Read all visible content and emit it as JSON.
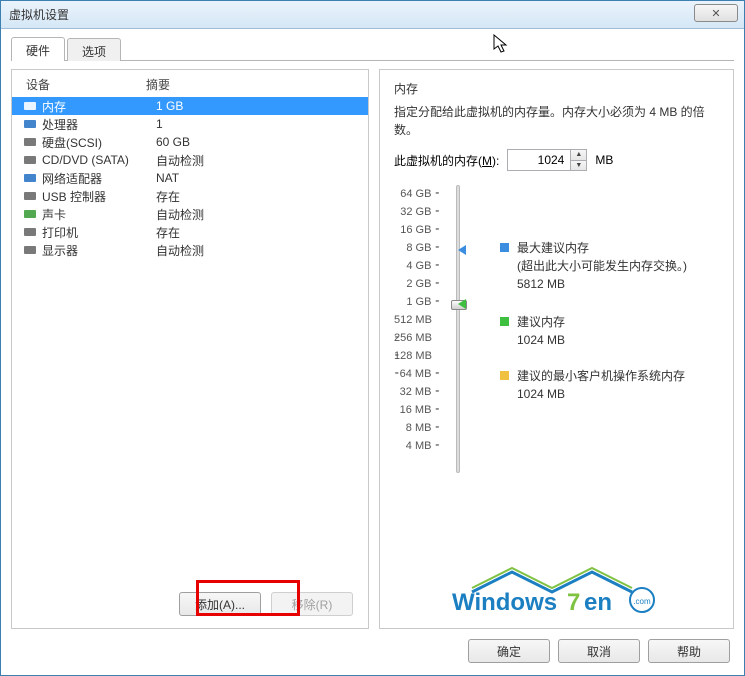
{
  "window": {
    "title": "虚拟机设置",
    "close": "✕"
  },
  "tabs": {
    "hardware": "硬件",
    "options": "选项"
  },
  "deviceHeader": {
    "device": "设备",
    "summary": "摘要"
  },
  "devices": [
    {
      "name": "内存",
      "summary": "1 GB",
      "selected": true
    },
    {
      "name": "处理器",
      "summary": "1"
    },
    {
      "name": "硬盘(SCSI)",
      "summary": "60 GB"
    },
    {
      "name": "CD/DVD (SATA)",
      "summary": "自动检测"
    },
    {
      "name": "网络适配器",
      "summary": "NAT"
    },
    {
      "name": "USB 控制器",
      "summary": "存在"
    },
    {
      "name": "声卡",
      "summary": "自动检测"
    },
    {
      "name": "打印机",
      "summary": "存在"
    },
    {
      "name": "显示器",
      "summary": "自动检测"
    }
  ],
  "leftButtons": {
    "add": "添加(A)...",
    "remove": "移除(R)"
  },
  "memory": {
    "title": "内存",
    "desc": "指定分配给此虚拟机的内存量。内存大小必须为 4 MB 的倍数。",
    "label_pre": "此虚拟机的内存(",
    "label_u": "M",
    "label_post": "):",
    "value": "1024",
    "unit": "MB",
    "scale": [
      "64 GB",
      "32 GB",
      "16 GB",
      "8 GB",
      "4 GB",
      "2 GB",
      "1 GB",
      "512 MB",
      "256 MB",
      "128 MB",
      "64 MB",
      "32 MB",
      "16 MB",
      "8 MB",
      "4 MB"
    ],
    "max_rec_title": "最大建议内存",
    "max_rec_desc": "(超出此大小可能发生内存交换。)",
    "max_rec_val": "5812 MB",
    "rec_title": "建议内存",
    "rec_val": "1024 MB",
    "min_rec_title": "建议的最小客户机操作系统内存",
    "min_rec_val": "1024 MB"
  },
  "bottom": {
    "ok": "确定",
    "cancel": "取消",
    "help": "帮助"
  },
  "logo": {
    "text": "Windows7en",
    "suffix": ".com"
  },
  "colors": {
    "blue": "#3b8de0",
    "green": "#3fbf3f",
    "orange": "#f0c040"
  }
}
